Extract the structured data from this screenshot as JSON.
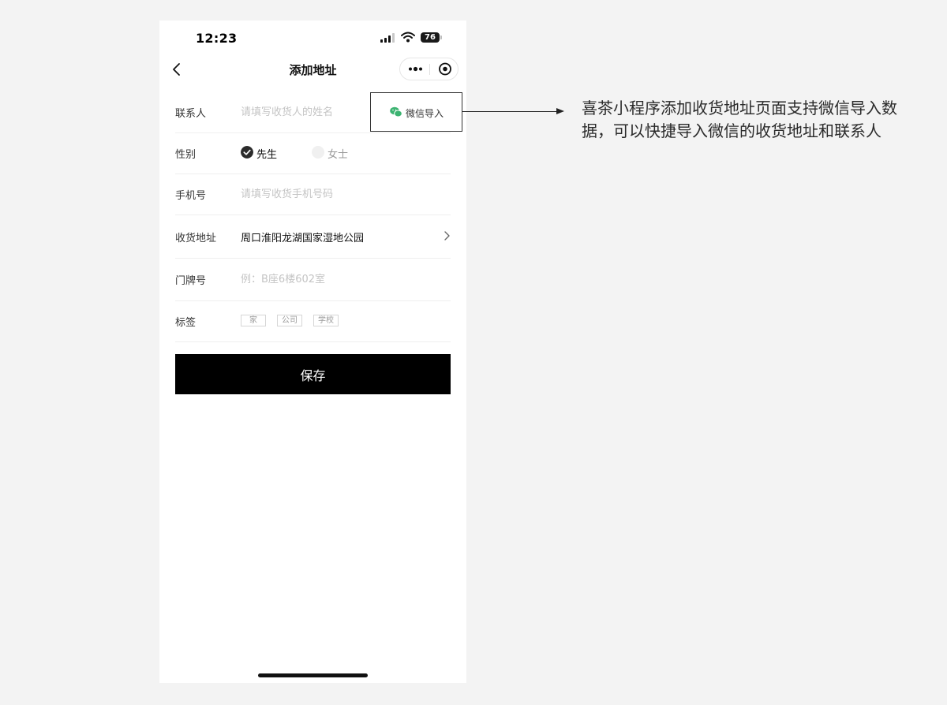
{
  "status_bar": {
    "time": "12:23",
    "battery": "76"
  },
  "nav": {
    "title": "添加地址"
  },
  "form": {
    "contact": {
      "label": "联系人",
      "placeholder": "请填写收货人的姓名",
      "wechat_import_label": "微信导入"
    },
    "gender": {
      "label": "性别",
      "options": [
        {
          "label": "先生",
          "selected": true
        },
        {
          "label": "女士",
          "selected": false
        }
      ]
    },
    "phone": {
      "label": "手机号",
      "placeholder": "请填写收货手机号码"
    },
    "address": {
      "label": "收货地址",
      "value": "周口淮阳龙湖国家湿地公园"
    },
    "door_number": {
      "label": "门牌号",
      "placeholder": "例：B座6楼602室"
    },
    "tags": {
      "label": "标签",
      "options": [
        "家",
        "公司",
        "学校"
      ]
    }
  },
  "save_button": {
    "label": "保存"
  },
  "annotation": {
    "text": "喜茶小程序添加收货地址页面支持微信导入数据，可以快捷导入微信的收货地址和联系人"
  },
  "colors": {
    "page_background": "#f3f3f3",
    "primary_button": "#000000",
    "wechat_green": "#3cb371",
    "placeholder": "#c4c4c4"
  },
  "icons": {
    "back": "chevron-left-icon",
    "more": "more-dots-icon",
    "close": "target-circle-icon",
    "wechat": "wechat-icon",
    "radio_checked": "check-circle-icon",
    "address_arrow": "chevron-right-icon"
  }
}
